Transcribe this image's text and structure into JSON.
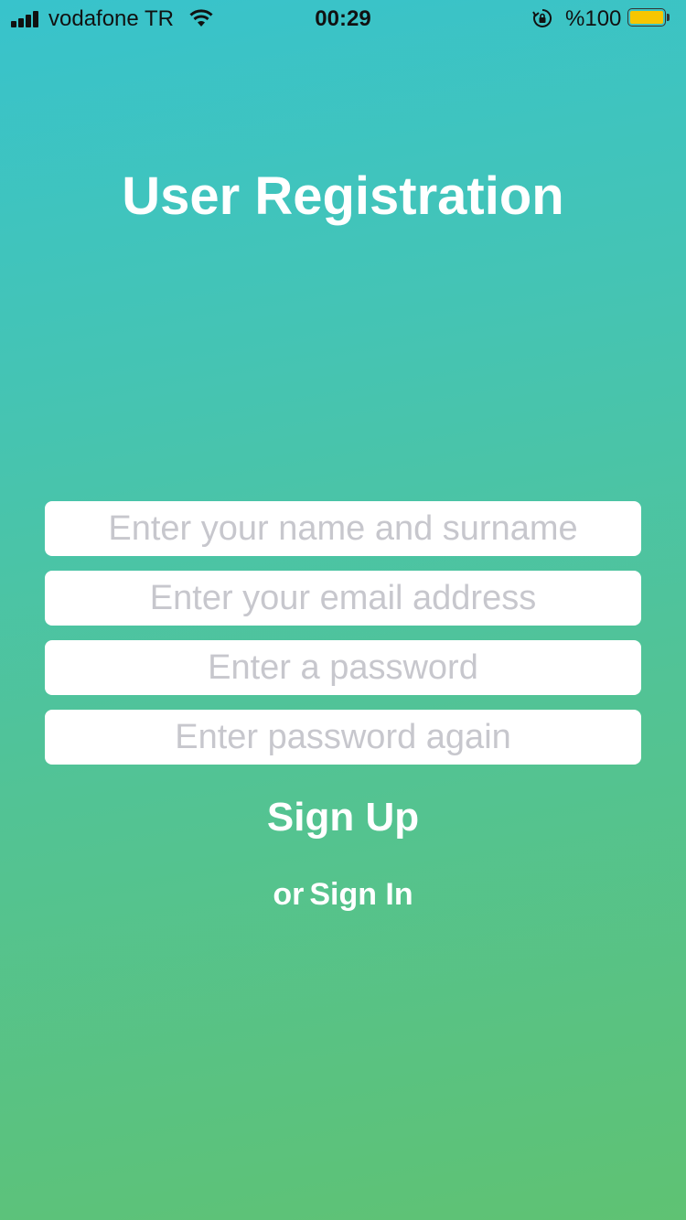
{
  "status_bar": {
    "carrier": "vodafone TR",
    "time": "00:29",
    "battery_percent": "%100",
    "signal_bars": 4,
    "battery_level": 1.0,
    "battery_color": "#f7c600"
  },
  "title": "User Registration",
  "form": {
    "name_placeholder": "Enter your name and surname",
    "email_placeholder": "Enter your email address",
    "password_placeholder": "Enter a password",
    "password_again_placeholder": "Enter password again",
    "signup_label": "Sign Up",
    "or_label": "or",
    "signin_label": "Sign In"
  },
  "colors": {
    "gradient_top": "#38c3cc",
    "gradient_bottom": "#5fc273",
    "placeholder": "#c7c7cd"
  }
}
